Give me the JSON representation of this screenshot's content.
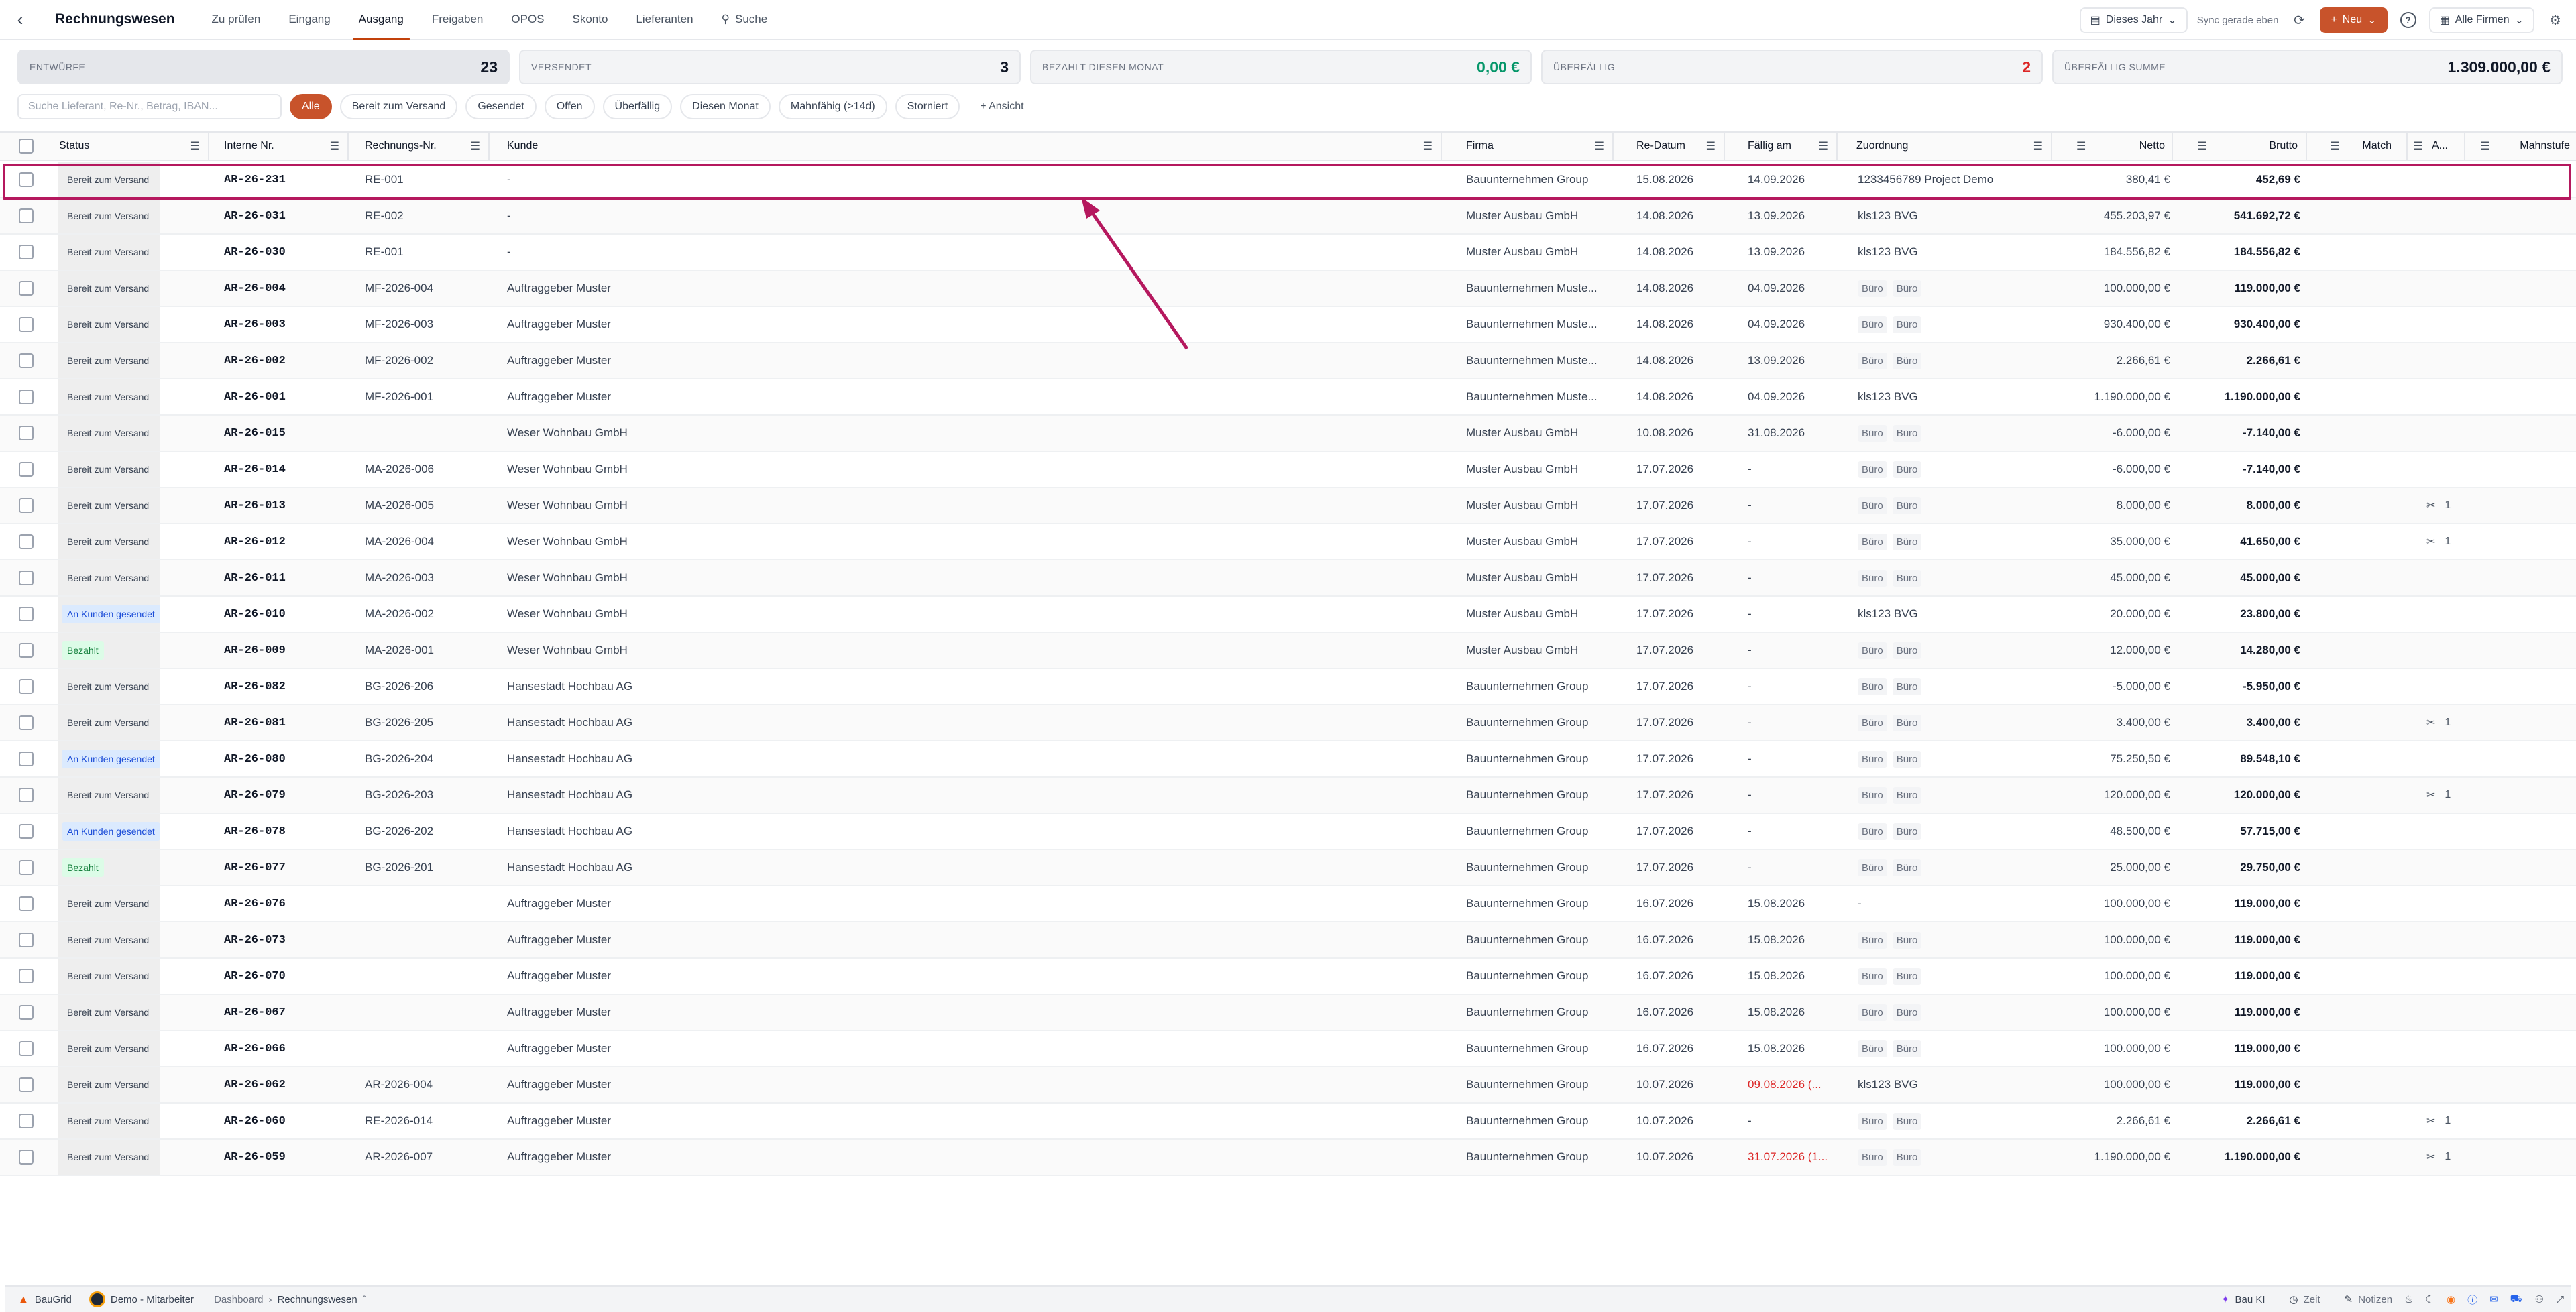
{
  "header": {
    "title": "Rechnungswesen",
    "tabs": [
      {
        "label": "Zu prüfen"
      },
      {
        "label": "Eingang"
      },
      {
        "label": "Ausgang"
      },
      {
        "label": "Freigaben"
      },
      {
        "label": "OPOS"
      },
      {
        "label": "Skonto"
      },
      {
        "label": "Lieferanten"
      },
      {
        "label": "Suche"
      }
    ],
    "year_filter": "Dieses Jahr",
    "sync_text": "Sync gerade eben",
    "new_label": "Neu",
    "company_filter": "Alle Firmen"
  },
  "kpis": [
    {
      "label": "ENTWÜRFE",
      "value": "23"
    },
    {
      "label": "VERSENDET",
      "value": "3"
    },
    {
      "label": "BEZAHLT DIESEN MONAT",
      "value": "0,00 €"
    },
    {
      "label": "ÜBERFÄLLIG",
      "value": "2"
    },
    {
      "label": "ÜBERFÄLLIG SUMME",
      "value": "1.309.000,00 €"
    }
  ],
  "filters": {
    "search_placeholder": "Suche Lieferant, Re-Nr., Betrag, IBAN...",
    "chips": [
      "Alle",
      "Bereit zum Versand",
      "Gesendet",
      "Offen",
      "Überfällig",
      "Diesen Monat",
      "Mahnfähig (>14d)",
      "Storniert",
      "+ Ansicht"
    ]
  },
  "columns": {
    "status": "Status",
    "internal": "Interne Nr.",
    "invoice": "Rechnungs-Nr.",
    "customer": "Kunde",
    "company": "Firma",
    "date": "Re-Datum",
    "due": "Fällig am",
    "assignment": "Zuordnung",
    "net": "Netto",
    "gross": "Brutto",
    "match": "Match",
    "attach": "A...",
    "dunning": "Mahnstufe"
  },
  "colors": {
    "accent": "#c8532b",
    "highlight": "#b5185e",
    "overdue": "#dc2626",
    "paid_green": "#059669"
  },
  "rows": [
    {
      "status": "Bereit zum Versand",
      "status_type": "ready",
      "internal": "AR-26-231",
      "invoice": "RE-001",
      "customer": "-",
      "company": "Bauunternehmen Group",
      "date": "15.08.2026",
      "due": "14.09.2026",
      "assign": "1233456789 Project Demo",
      "net": "380,41 €",
      "gross": "452,69 €",
      "attach": ""
    },
    {
      "status": "Bereit zum Versand",
      "status_type": "ready",
      "internal": "AR-26-031",
      "invoice": "RE-002",
      "customer": "-",
      "company": "Muster Ausbau GmbH",
      "date": "14.08.2026",
      "due": "13.09.2026",
      "assign": "kls123 BVG",
      "net": "455.203,97 €",
      "gross": "541.692,72 €",
      "attach": ""
    },
    {
      "status": "Bereit zum Versand",
      "status_type": "ready",
      "internal": "AR-26-030",
      "invoice": "RE-001",
      "customer": "-",
      "company": "Muster Ausbau GmbH",
      "date": "14.08.2026",
      "due": "13.09.2026",
      "assign": "kls123 BVG",
      "net": "184.556,82 €",
      "gross": "184.556,82 €",
      "attach": ""
    },
    {
      "status": "Bereit zum Versand",
      "status_type": "ready",
      "internal": "AR-26-004",
      "invoice": "MF-2026-004",
      "customer": "Auftraggeber Muster",
      "company": "Bauunternehmen Muste...",
      "date": "14.08.2026",
      "due": "04.09.2026",
      "assign_tags": [
        "Büro",
        "Büro"
      ],
      "net": "100.000,00 €",
      "gross": "119.000,00 €",
      "attach": ""
    },
    {
      "status": "Bereit zum Versand",
      "status_type": "ready",
      "internal": "AR-26-003",
      "invoice": "MF-2026-003",
      "customer": "Auftraggeber Muster",
      "company": "Bauunternehmen Muste...",
      "date": "14.08.2026",
      "due": "04.09.2026",
      "assign_tags": [
        "Büro",
        "Büro"
      ],
      "net": "930.400,00 €",
      "gross": "930.400,00 €",
      "attach": ""
    },
    {
      "status": "Bereit zum Versand",
      "status_type": "ready",
      "internal": "AR-26-002",
      "invoice": "MF-2026-002",
      "customer": "Auftraggeber Muster",
      "company": "Bauunternehmen Muste...",
      "date": "14.08.2026",
      "due": "13.09.2026",
      "assign_tags": [
        "Büro",
        "Büro"
      ],
      "net": "2.266,61 €",
      "gross": "2.266,61 €",
      "attach": ""
    },
    {
      "status": "Bereit zum Versand",
      "status_type": "ready",
      "internal": "AR-26-001",
      "invoice": "MF-2026-001",
      "customer": "Auftraggeber Muster",
      "company": "Bauunternehmen Muste...",
      "date": "14.08.2026",
      "due": "04.09.2026",
      "assign": "kls123 BVG",
      "net": "1.190.000,00 €",
      "gross": "1.190.000,00 €",
      "attach": ""
    },
    {
      "status": "Bereit zum Versand",
      "status_type": "ready",
      "internal": "AR-26-015",
      "invoice": "",
      "customer": "Weser Wohnbau GmbH",
      "company": "Muster Ausbau GmbH",
      "date": "10.08.2026",
      "due": "31.08.2026",
      "assign_tags": [
        "Büro",
        "Büro"
      ],
      "net": "-6.000,00 €",
      "gross": "-7.140,00 €",
      "attach": ""
    },
    {
      "status": "Bereit zum Versand",
      "status_type": "ready",
      "internal": "AR-26-014",
      "invoice": "MA-2026-006",
      "customer": "Weser Wohnbau GmbH",
      "company": "Muster Ausbau GmbH",
      "date": "17.07.2026",
      "due": "-",
      "assign_tags": [
        "Büro",
        "Büro"
      ],
      "net": "-6.000,00 €",
      "gross": "-7.140,00 €",
      "attach": ""
    },
    {
      "status": "Bereit zum Versand",
      "status_type": "ready",
      "internal": "AR-26-013",
      "invoice": "MA-2026-005",
      "customer": "Weser Wohnbau GmbH",
      "company": "Muster Ausbau GmbH",
      "date": "17.07.2026",
      "due": "-",
      "assign_tags": [
        "Büro",
        "Büro"
      ],
      "net": "8.000,00 €",
      "gross": "8.000,00 €",
      "attach": "1"
    },
    {
      "status": "Bereit zum Versand",
      "status_type": "ready",
      "internal": "AR-26-012",
      "invoice": "MA-2026-004",
      "customer": "Weser Wohnbau GmbH",
      "company": "Muster Ausbau GmbH",
      "date": "17.07.2026",
      "due": "-",
      "assign_tags": [
        "Büro",
        "Büro"
      ],
      "net": "35.000,00 €",
      "gross": "41.650,00 €",
      "attach": "1"
    },
    {
      "status": "Bereit zum Versand",
      "status_type": "ready",
      "internal": "AR-26-011",
      "invoice": "MA-2026-003",
      "customer": "Weser Wohnbau GmbH",
      "company": "Muster Ausbau GmbH",
      "date": "17.07.2026",
      "due": "-",
      "assign_tags": [
        "Büro",
        "Büro"
      ],
      "net": "45.000,00 €",
      "gross": "45.000,00 €",
      "attach": ""
    },
    {
      "status": "An Kunden gesendet",
      "status_type": "sent",
      "internal": "AR-26-010",
      "invoice": "MA-2026-002",
      "customer": "Weser Wohnbau GmbH",
      "company": "Muster Ausbau GmbH",
      "date": "17.07.2026",
      "due": "-",
      "assign": "kls123 BVG",
      "net": "20.000,00 €",
      "gross": "23.800,00 €",
      "attach": ""
    },
    {
      "status": "Bezahlt",
      "status_type": "paid",
      "internal": "AR-26-009",
      "invoice": "MA-2026-001",
      "customer": "Weser Wohnbau GmbH",
      "company": "Muster Ausbau GmbH",
      "date": "17.07.2026",
      "due": "-",
      "assign_tags": [
        "Büro",
        "Büro"
      ],
      "net": "12.000,00 €",
      "gross": "14.280,00 €",
      "attach": ""
    },
    {
      "status": "Bereit zum Versand",
      "status_type": "ready",
      "internal": "AR-26-082",
      "invoice": "BG-2026-206",
      "customer": "Hansestadt Hochbau AG",
      "company": "Bauunternehmen Group",
      "date": "17.07.2026",
      "due": "-",
      "assign_tags": [
        "Büro",
        "Büro"
      ],
      "net": "-5.000,00 €",
      "gross": "-5.950,00 €",
      "attach": ""
    },
    {
      "status": "Bereit zum Versand",
      "status_type": "ready",
      "internal": "AR-26-081",
      "invoice": "BG-2026-205",
      "customer": "Hansestadt Hochbau AG",
      "company": "Bauunternehmen Group",
      "date": "17.07.2026",
      "due": "-",
      "assign_tags": [
        "Büro",
        "Büro"
      ],
      "net": "3.400,00 €",
      "gross": "3.400,00 €",
      "attach": "1"
    },
    {
      "status": "An Kunden gesendet",
      "status_type": "sent",
      "internal": "AR-26-080",
      "invoice": "BG-2026-204",
      "customer": "Hansestadt Hochbau AG",
      "company": "Bauunternehmen Group",
      "date": "17.07.2026",
      "due": "-",
      "assign_tags": [
        "Büro",
        "Büro"
      ],
      "net": "75.250,50 €",
      "gross": "89.548,10 €",
      "attach": ""
    },
    {
      "status": "Bereit zum Versand",
      "status_type": "ready",
      "internal": "AR-26-079",
      "invoice": "BG-2026-203",
      "customer": "Hansestadt Hochbau AG",
      "company": "Bauunternehmen Group",
      "date": "17.07.2026",
      "due": "-",
      "assign_tags": [
        "Büro",
        "Büro"
      ],
      "net": "120.000,00 €",
      "gross": "120.000,00 €",
      "attach": "1"
    },
    {
      "status": "An Kunden gesendet",
      "status_type": "sent",
      "internal": "AR-26-078",
      "invoice": "BG-2026-202",
      "customer": "Hansestadt Hochbau AG",
      "company": "Bauunternehmen Group",
      "date": "17.07.2026",
      "due": "-",
      "assign_tags": [
        "Büro",
        "Büro"
      ],
      "net": "48.500,00 €",
      "gross": "57.715,00 €",
      "attach": ""
    },
    {
      "status": "Bezahlt",
      "status_type": "paid",
      "internal": "AR-26-077",
      "invoice": "BG-2026-201",
      "customer": "Hansestadt Hochbau AG",
      "company": "Bauunternehmen Group",
      "date": "17.07.2026",
      "due": "-",
      "assign_tags": [
        "Büro",
        "Büro"
      ],
      "net": "25.000,00 €",
      "gross": "29.750,00 €",
      "attach": ""
    },
    {
      "status": "Bereit zum Versand",
      "status_type": "ready",
      "internal": "AR-26-076",
      "invoice": "",
      "customer": "Auftraggeber Muster",
      "company": "Bauunternehmen Group",
      "date": "16.07.2026",
      "due": "15.08.2026",
      "assign": "-",
      "net": "100.000,00 €",
      "gross": "119.000,00 €",
      "attach": ""
    },
    {
      "status": "Bereit zum Versand",
      "status_type": "ready",
      "internal": "AR-26-073",
      "invoice": "",
      "customer": "Auftraggeber Muster",
      "company": "Bauunternehmen Group",
      "date": "16.07.2026",
      "due": "15.08.2026",
      "assign_tags": [
        "Büro",
        "Büro"
      ],
      "net": "100.000,00 €",
      "gross": "119.000,00 €",
      "attach": ""
    },
    {
      "status": "Bereit zum Versand",
      "status_type": "ready",
      "internal": "AR-26-070",
      "invoice": "",
      "customer": "Auftraggeber Muster",
      "company": "Bauunternehmen Group",
      "date": "16.07.2026",
      "due": "15.08.2026",
      "assign_tags": [
        "Büro",
        "Büro"
      ],
      "net": "100.000,00 €",
      "gross": "119.000,00 €",
      "attach": ""
    },
    {
      "status": "Bereit zum Versand",
      "status_type": "ready",
      "internal": "AR-26-067",
      "invoice": "",
      "customer": "Auftraggeber Muster",
      "company": "Bauunternehmen Group",
      "date": "16.07.2026",
      "due": "15.08.2026",
      "assign_tags": [
        "Büro",
        "Büro"
      ],
      "net": "100.000,00 €",
      "gross": "119.000,00 €",
      "attach": ""
    },
    {
      "status": "Bereit zum Versand",
      "status_type": "ready",
      "internal": "AR-26-066",
      "invoice": "",
      "customer": "Auftraggeber Muster",
      "company": "Bauunternehmen Group",
      "date": "16.07.2026",
      "due": "15.08.2026",
      "assign_tags": [
        "Büro",
        "Büro"
      ],
      "net": "100.000,00 €",
      "gross": "119.000,00 €",
      "attach": ""
    },
    {
      "status": "Bereit zum Versand",
      "status_type": "ready",
      "internal": "AR-26-062",
      "invoice": "AR-2026-004",
      "customer": "Auftraggeber Muster",
      "company": "Bauunternehmen Group",
      "date": "10.07.2026",
      "due": "09.08.2026 (...",
      "due_overdue": true,
      "assign": "kls123 BVG",
      "net": "100.000,00 €",
      "gross": "119.000,00 €",
      "attach": ""
    },
    {
      "status": "Bereit zum Versand",
      "status_type": "ready",
      "internal": "AR-26-060",
      "invoice": "RE-2026-014",
      "customer": "Auftraggeber Muster",
      "company": "Bauunternehmen Group",
      "date": "10.07.2026",
      "due": "-",
      "assign_tags": [
        "Büro",
        "Büro"
      ],
      "net": "2.266,61 €",
      "gross": "2.266,61 €",
      "attach": "1"
    },
    {
      "status": "Bereit zum Versand",
      "status_type": "ready",
      "internal": "AR-26-059",
      "invoice": "AR-2026-007",
      "customer": "Auftraggeber Muster",
      "company": "Bauunternehmen Group",
      "date": "10.07.2026",
      "due": "31.07.2026 (1...",
      "due_overdue": true,
      "assign_tags": [
        "Büro",
        "Büro"
      ],
      "net": "1.190.000,00 €",
      "gross": "1.190.000,00 €",
      "attach": "1"
    }
  ],
  "footer": {
    "brand": "BauGrid",
    "user": "Demo - Mitarbeiter",
    "breadcrumb_root": "Dashboard",
    "breadcrumb_current": "Rechnungswesen",
    "ai_label": "Bau KI",
    "time_label": "Zeit",
    "notes_label": "Notizen"
  }
}
